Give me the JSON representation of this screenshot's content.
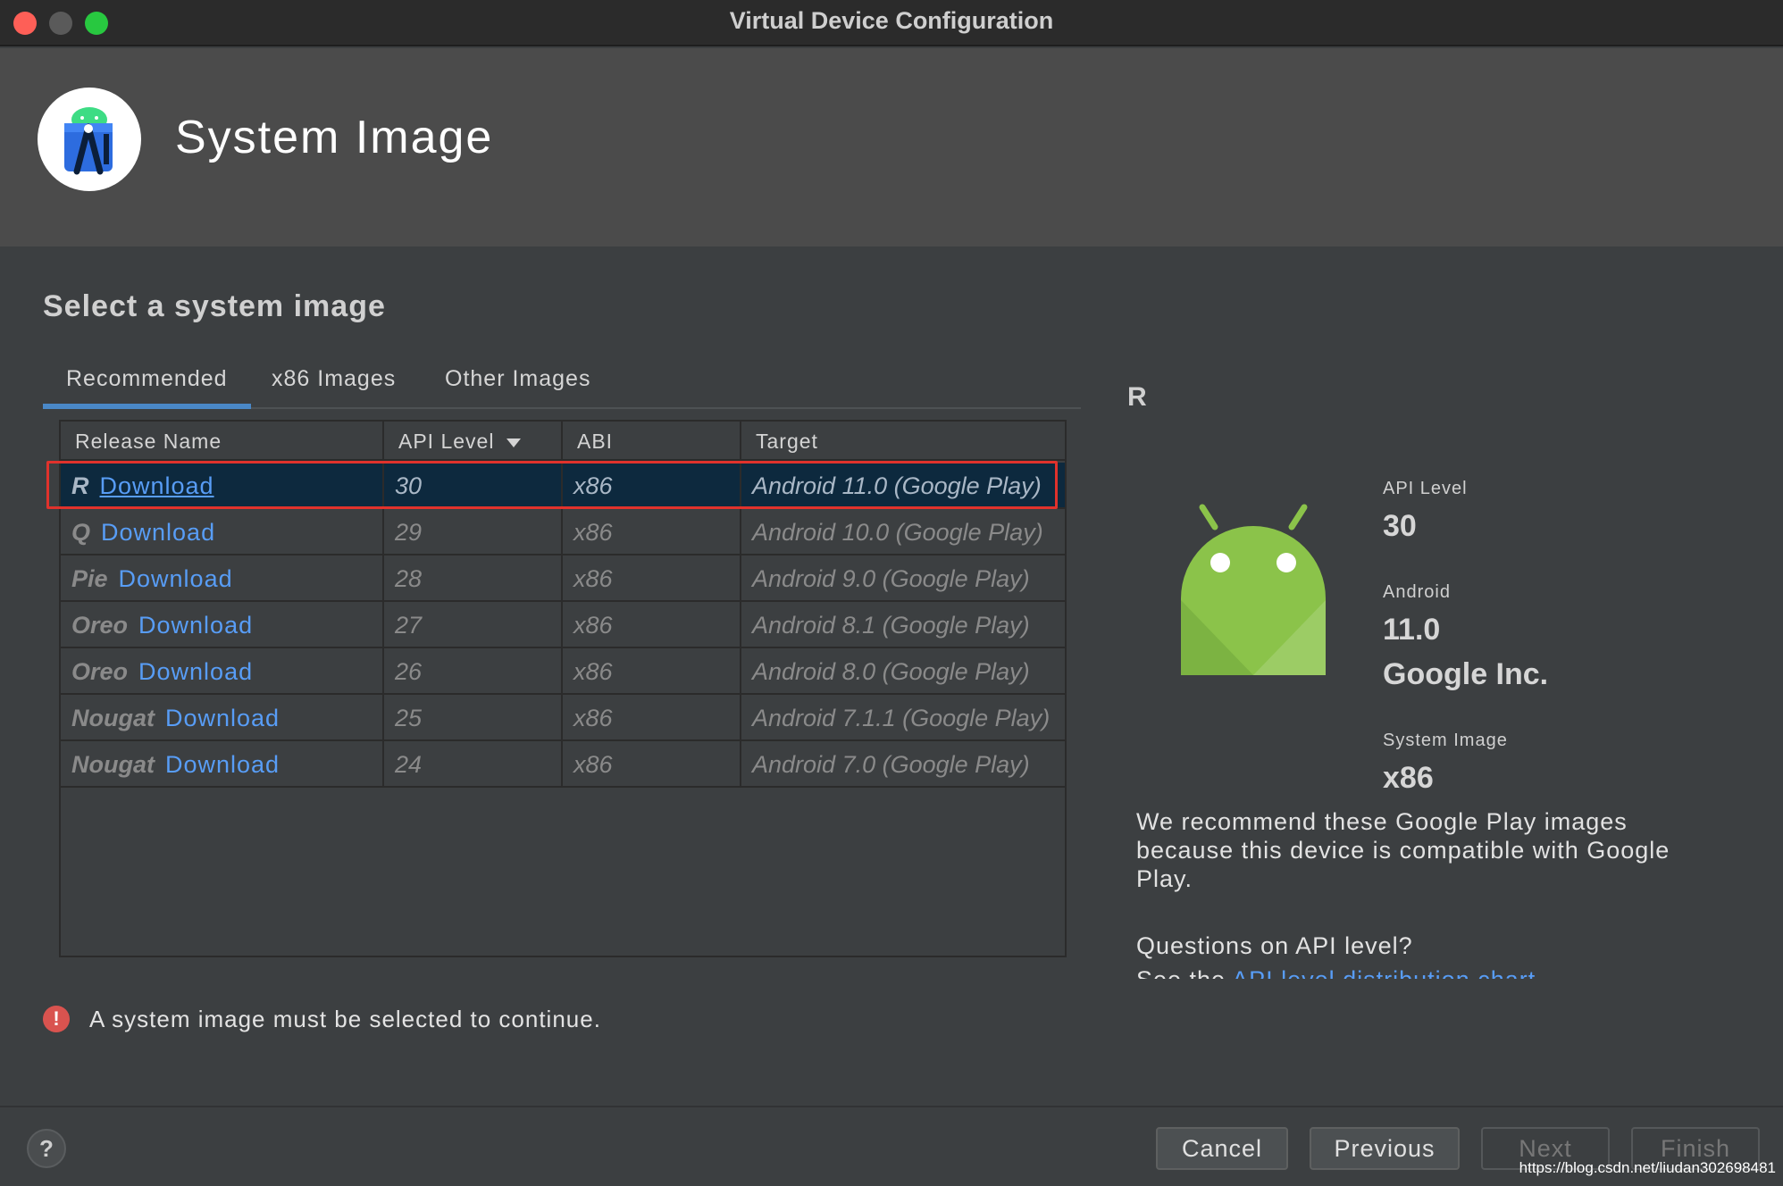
{
  "window": {
    "title": "Virtual Device Configuration"
  },
  "header": {
    "title": "System Image"
  },
  "section_title": "Select a system image",
  "tabs": [
    {
      "label": "Recommended",
      "active": true
    },
    {
      "label": "x86 Images",
      "active": false
    },
    {
      "label": "Other Images",
      "active": false
    }
  ],
  "table": {
    "columns": [
      "Release Name",
      "API Level",
      "ABI",
      "Target"
    ],
    "sort_column": "API Level",
    "sort_direction": "descending",
    "rows": [
      {
        "name": "R",
        "action": "Download",
        "api": "30",
        "abi": "x86",
        "target": "Android 11.0 (Google Play)",
        "selected": true
      },
      {
        "name": "Q",
        "action": "Download",
        "api": "29",
        "abi": "x86",
        "target": "Android 10.0 (Google Play)",
        "selected": false
      },
      {
        "name": "Pie",
        "action": "Download",
        "api": "28",
        "abi": "x86",
        "target": "Android 9.0 (Google Play)",
        "selected": false
      },
      {
        "name": "Oreo",
        "action": "Download",
        "api": "27",
        "abi": "x86",
        "target": "Android 8.1 (Google Play)",
        "selected": false
      },
      {
        "name": "Oreo",
        "action": "Download",
        "api": "26",
        "abi": "x86",
        "target": "Android 8.0 (Google Play)",
        "selected": false
      },
      {
        "name": "Nougat",
        "action": "Download",
        "api": "25",
        "abi": "x86",
        "target": "Android 7.1.1 (Google Play)",
        "selected": false
      },
      {
        "name": "Nougat",
        "action": "Download",
        "api": "24",
        "abi": "x86",
        "target": "Android 7.0 (Google Play)",
        "selected": false
      }
    ]
  },
  "error": {
    "icon": "error-icon",
    "text": "A system image must be selected to continue."
  },
  "details": {
    "release_letter": "R",
    "api_level_label": "API Level",
    "api_level_value": "30",
    "android_label": "Android",
    "android_value": "11.0",
    "vendor": "Google Inc.",
    "system_image_label": "System Image",
    "system_image_value": "x86",
    "recommendation": "We recommend these Google Play images because this device is compatible with Google Play.",
    "question": "Questions on API level?",
    "see_prefix": "See the ",
    "see_link": "API level distribution chart"
  },
  "footer": {
    "help": "?",
    "buttons": {
      "cancel": "Cancel",
      "previous": "Previous",
      "next": "Next",
      "finish": "Finish"
    }
  },
  "watermark": "https://blog.csdn.net/liudan302698481",
  "colors": {
    "accent": "#4a88c7",
    "link": "#589df6",
    "highlight_box": "#e0322c",
    "selected_row": "#0d293e",
    "android_green": "#8bc34a"
  }
}
